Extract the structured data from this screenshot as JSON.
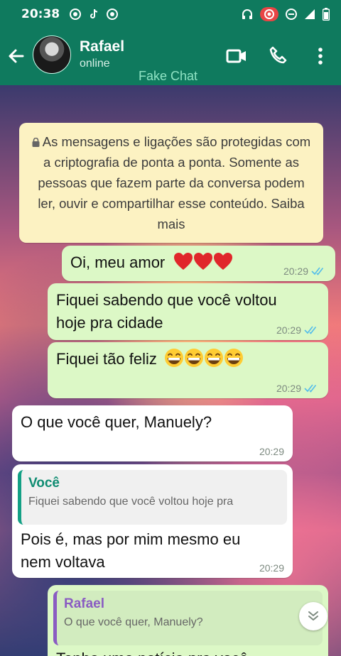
{
  "status_bar": {
    "time": "20:38"
  },
  "header": {
    "contact_name": "Rafael",
    "contact_status": "online",
    "watermark": "Fake Chat"
  },
  "encryption_notice": "As mensagens e ligações são protegidas com a criptografia de ponta a ponta. Somente as pessoas que fazem parte da conversa podem ler, ouvir e compartilhar esse conteúdo. Saiba mais",
  "messages": [
    {
      "direction": "out",
      "text": "Oi, meu amor",
      "emoji_count": 3,
      "emoji": "heart",
      "time": "20:29"
    },
    {
      "direction": "out",
      "text_line1": "Fiquei sabendo que você voltou",
      "text_line2": "hoje pra cidade",
      "time": "20:29"
    },
    {
      "direction": "out",
      "text": "Fiquei tão feliz",
      "emoji_count": 4,
      "emoji": "grin",
      "time": "20:29"
    },
    {
      "direction": "in",
      "text": "O que você quer, Manuely?",
      "time": "20:29"
    },
    {
      "direction": "in",
      "quote_author": "Você",
      "quote_text": "Fiquei sabendo que você voltou hoje pra",
      "text_line1": "Pois é, mas por mim mesmo eu",
      "text_line2": "nem voltava",
      "time": "20:29"
    },
    {
      "direction": "out",
      "quote_author": "Rafael",
      "quote_text": "O que você quer, Manuely?",
      "text": "Tenho uma notícia pra você"
    }
  ],
  "colors": {
    "header": "#0f7a5e",
    "outgoing_bubble": "#dcf8c6",
    "incoming_bubble": "#ffffff",
    "ticks": "#53bdeb"
  }
}
